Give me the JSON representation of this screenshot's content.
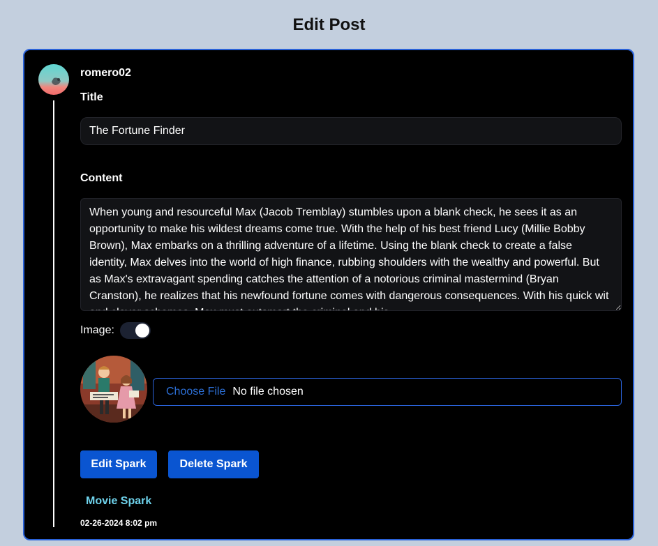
{
  "page": {
    "title": "Edit Post"
  },
  "post": {
    "username": "romero02",
    "title_label": "Title",
    "title_value": "The Fortune Finder",
    "content_label": "Content",
    "content_value": "When young and resourceful Max (Jacob Tremblay) stumbles upon a blank check, he sees it as an opportunity to make his wildest dreams come true. With the help of his best friend Lucy (Millie Bobby Brown), Max embarks on a thrilling adventure of a lifetime. Using the blank check to create a false identity, Max delves into the world of high finance, rubbing shoulders with the wealthy and powerful. But as Max's extravagant spending catches the attention of a notorious criminal mastermind (Bryan Cranston), he realizes that his newfound fortune comes with dangerous consequences. With his quick wit and clever schemes, Max must outsmart the criminal and his",
    "image_label": "Image:",
    "image_toggle_on": true,
    "file_button": "Choose File",
    "file_status": "No file chosen",
    "edit_button": "Edit Spark",
    "delete_button": "Delete Spark",
    "category": "Movie Spark",
    "timestamp": "02-26-2024 8:02 pm"
  },
  "colors": {
    "background": "#c3cfde",
    "card": "#000000",
    "card_border": "#2a62d8",
    "button": "#0a55d1",
    "category_link": "#6fd3ec"
  }
}
